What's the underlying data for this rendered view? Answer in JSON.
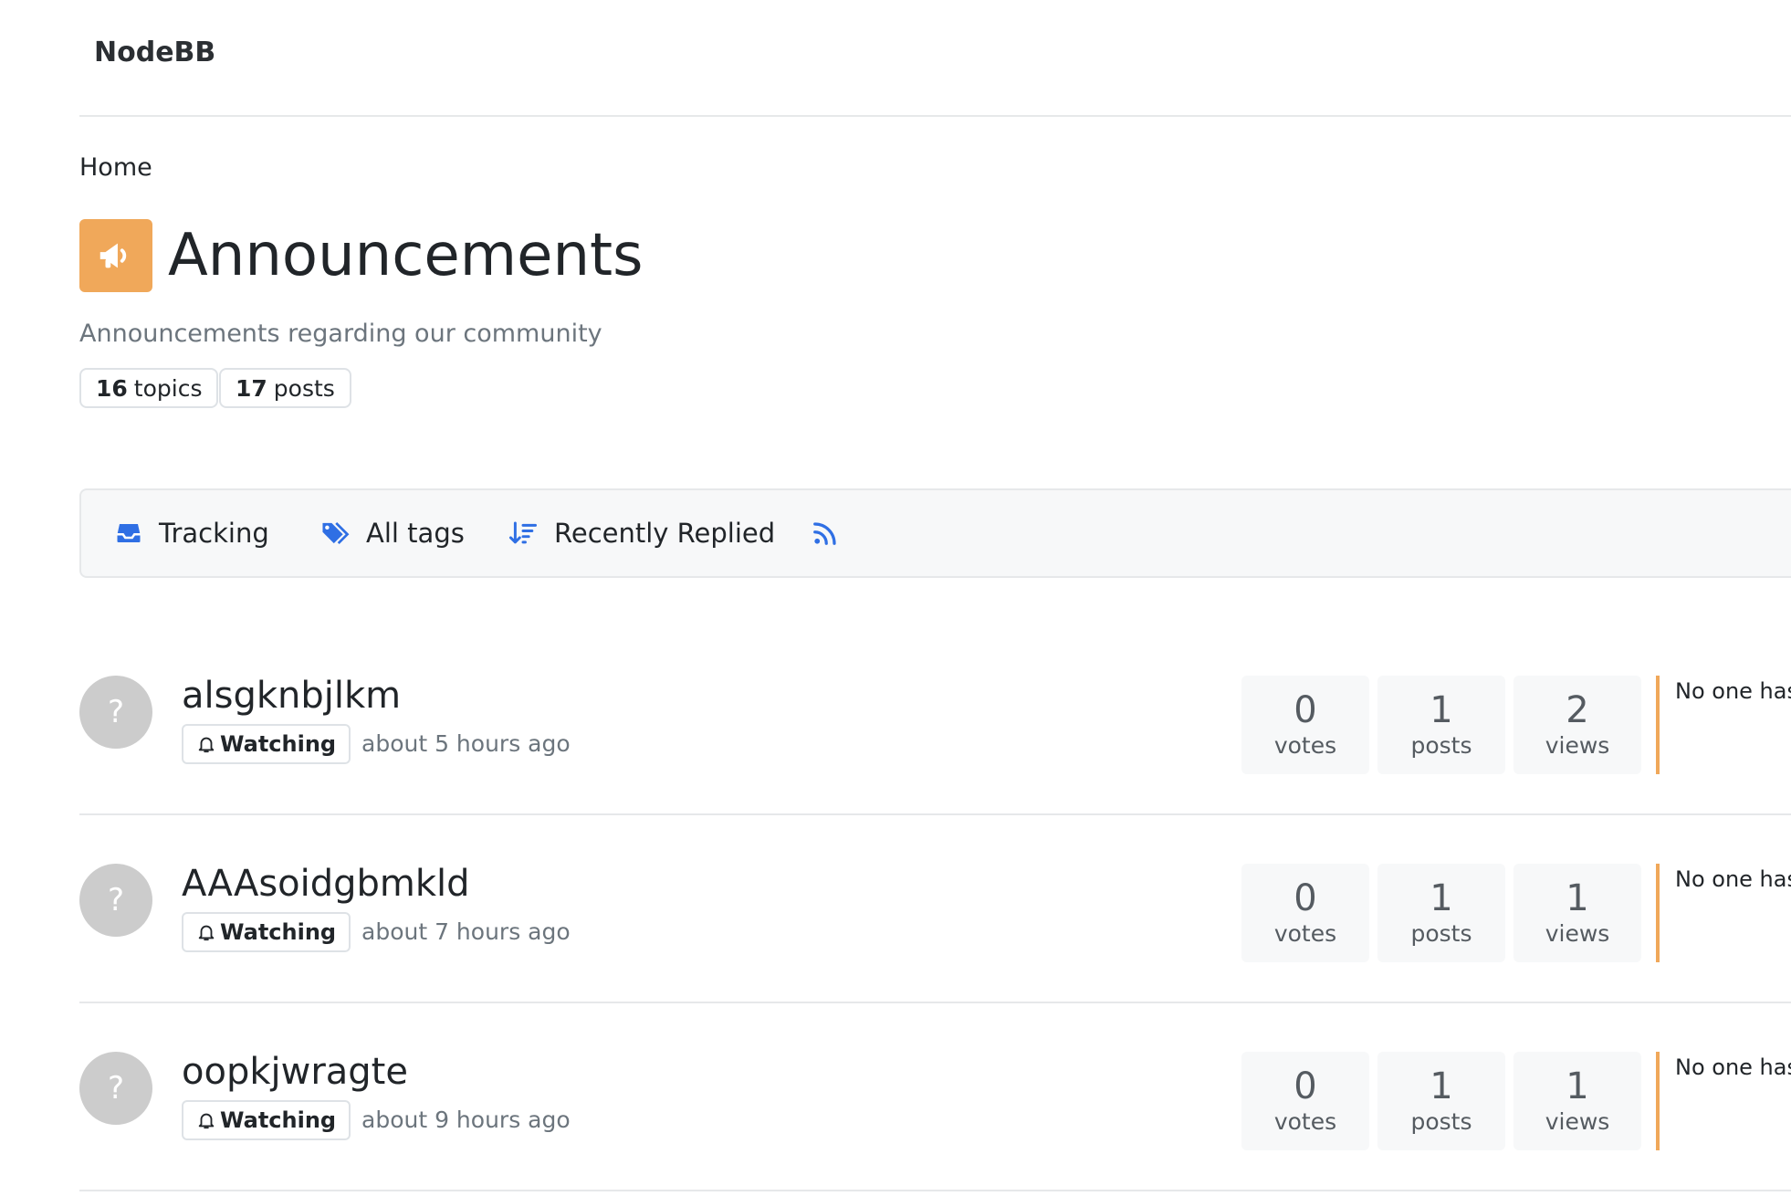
{
  "header": {
    "brand": "NodeBB"
  },
  "breadcrumb": {
    "home": "Home"
  },
  "category": {
    "title": "Announcements",
    "description": "Announcements regarding our community",
    "icon": "megaphone-icon",
    "icon_color": "#f0a85a",
    "topics_count": "16",
    "topics_label": "topics",
    "posts_count": "17",
    "posts_label": "posts"
  },
  "toolbar": {
    "tracking_label": "Tracking",
    "tags_label": "All tags",
    "sort_label": "Recently Replied",
    "accent_color": "#2f6fe4"
  },
  "topics": [
    {
      "avatar_text": "?",
      "title": "alsgknbjlkm",
      "watch_label": "Watching",
      "time": "about 5 hours ago",
      "votes": "0",
      "votes_label": "votes",
      "posts": "1",
      "posts_label": "posts",
      "views": "2",
      "views_label": "views",
      "teaser": "No one has"
    },
    {
      "avatar_text": "?",
      "title": "AAAsoidgbmkld",
      "watch_label": "Watching",
      "time": "about 7 hours ago",
      "votes": "0",
      "votes_label": "votes",
      "posts": "1",
      "posts_label": "posts",
      "views": "1",
      "views_label": "views",
      "teaser": "No one has"
    },
    {
      "avatar_text": "?",
      "title": "oopkjwragte",
      "watch_label": "Watching",
      "time": "about 9 hours ago",
      "votes": "0",
      "votes_label": "votes",
      "posts": "1",
      "posts_label": "posts",
      "views": "1",
      "views_label": "views",
      "teaser": "No one has"
    }
  ]
}
